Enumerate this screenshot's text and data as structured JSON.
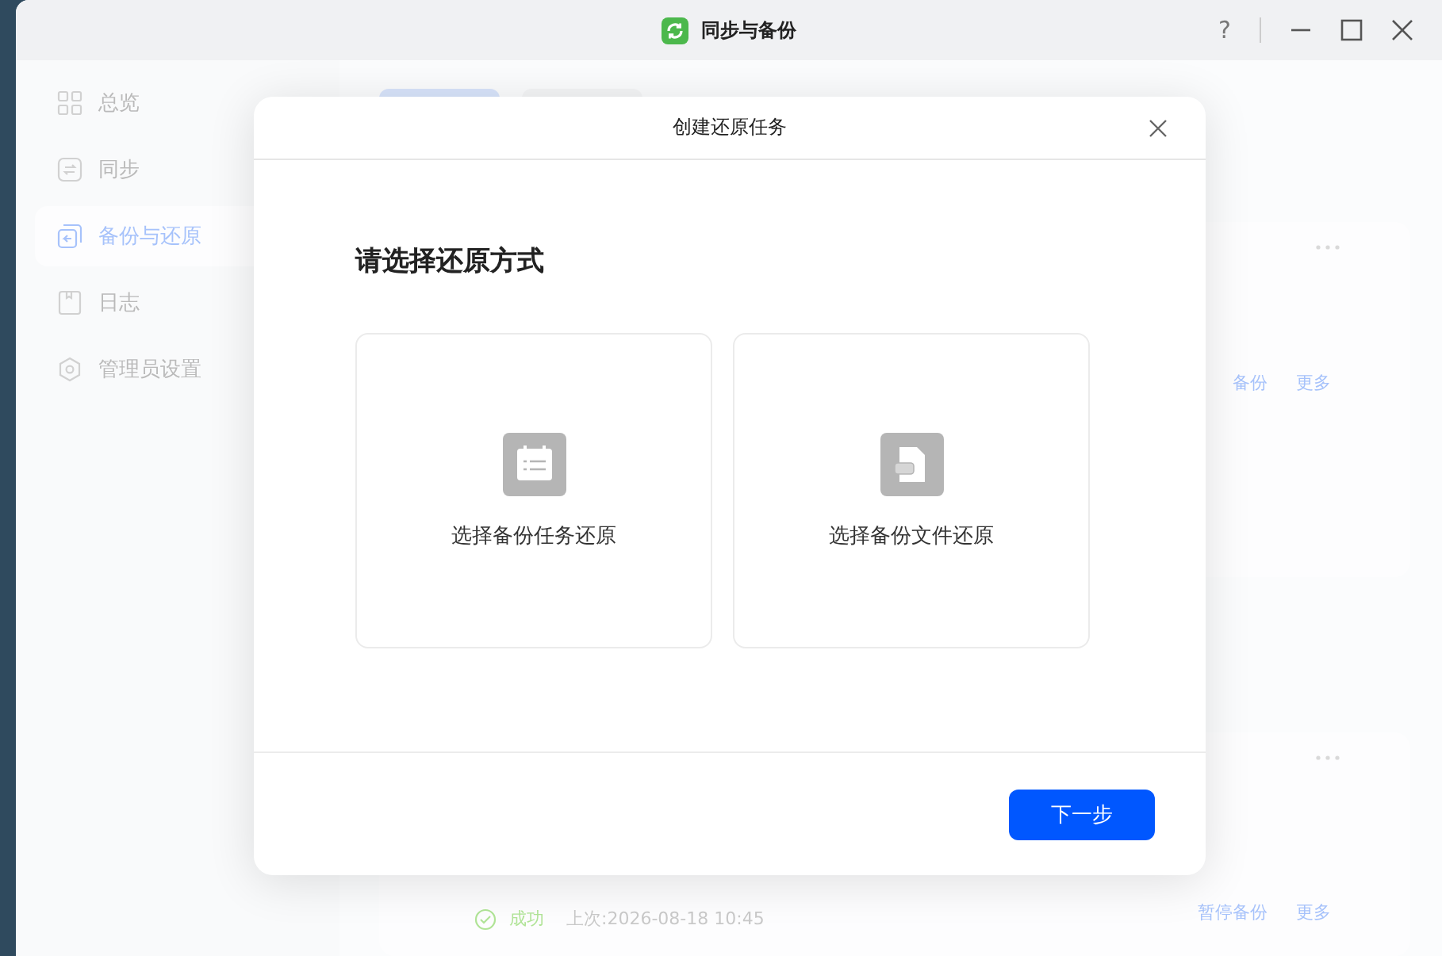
{
  "window": {
    "title": "同步与备份",
    "help_label": "?"
  },
  "sidebar": {
    "items": [
      {
        "label": "总览",
        "kind": "overview",
        "selected": false
      },
      {
        "label": "同步",
        "kind": "sync",
        "selected": false
      },
      {
        "label": "备份与还原",
        "kind": "backup",
        "selected": true
      },
      {
        "label": "日志",
        "kind": "log",
        "selected": false
      },
      {
        "label": "管理员设置",
        "kind": "settings",
        "selected": false
      }
    ]
  },
  "background": {
    "tasks": [
      {
        "actions": [
          "备份",
          "更多"
        ]
      },
      {
        "status": "成功",
        "last_run": "上次:2026-08-18 10:45",
        "actions": [
          "暂停备份",
          "更多"
        ]
      }
    ]
  },
  "dialog": {
    "title": "创建还原任务",
    "heading": "请选择还原方式",
    "options": [
      {
        "label": "选择备份任务还原",
        "kind": "task"
      },
      {
        "label": "选择备份文件还原",
        "kind": "file"
      }
    ],
    "next_button": "下一步"
  }
}
